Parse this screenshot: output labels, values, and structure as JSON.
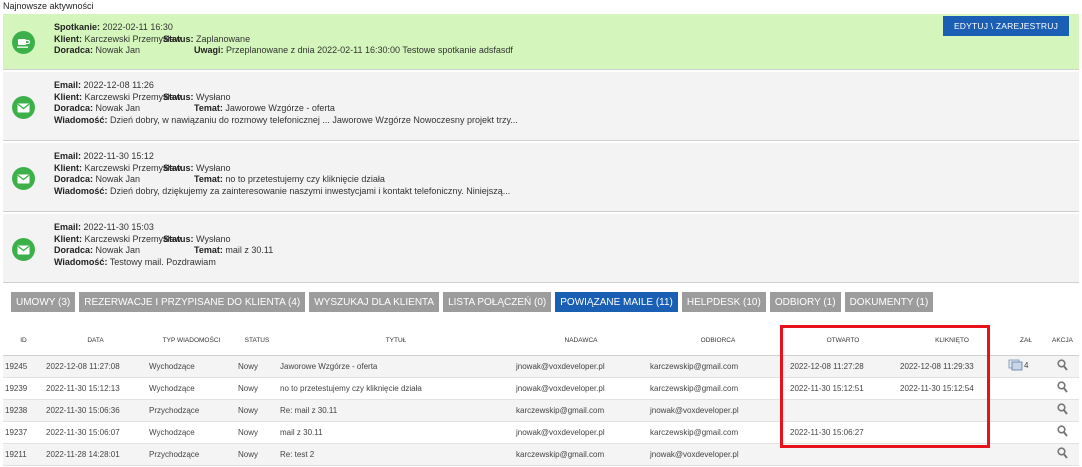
{
  "section_title": "Najnowsze aktywności",
  "labels": {
    "klient": "Klient",
    "doradca": "Doradca",
    "status": "Status",
    "temat": "Temat",
    "uwagi": "Uwagi",
    "wiadomosc": "Wiadomość",
    "spotkanie": "Spotkanie",
    "email": "Email"
  },
  "edit_button": "EDYTUJ \\ ZAREJESTRUJ",
  "activities": [
    {
      "date": "2022-02-11 16:30",
      "client": "Karczewski Przemysław",
      "status": "Zaplanowane",
      "advisor": "Nowak Jan",
      "notes": "Przeplanowane z dnia 2022-02-11 16:30:00 Testowe spotkanie adsfasdf"
    },
    {
      "date": "2022-12-08 11:26",
      "client": "Karczewski Przemysław",
      "status": "Wysłano",
      "advisor": "Nowak Jan",
      "subject": "Jaworowe Wzgórze - oferta",
      "message": "Dzień dobry, w nawiązaniu do rozmowy telefonicznej ...  Jaworowe Wzgórze Nowoczesny projekt trzy..."
    },
    {
      "date": "2022-11-30 15:12",
      "client": "Karczewski Przemysław",
      "status": "Wysłano",
      "advisor": "Nowak Jan",
      "subject": "no to przetestujemy czy kliknięcie działa",
      "message": "Dzień dobry, dziękujemy za zainteresowanie naszymi inwestycjami i kontakt telefoniczny. Niniejszą..."
    },
    {
      "date": "2022-11-30 15:03",
      "client": "Karczewski Przemysław",
      "status": "Wysłano",
      "advisor": "Nowak Jan",
      "subject": "mail z 30.11",
      "message": "Testowy mail. Pozdrawiam"
    }
  ],
  "tabs": [
    "UMOWY (3)",
    "REZERWACJE I PRZYPISANE DO KLIENTA (4)",
    "WYSZUKAJ DLA KLIENTA",
    "LISTA POŁĄCZEŃ (0)",
    "POWIĄZANE MAILE (11)",
    "HELPDESK (10)",
    "ODBIORY (1)",
    "DOKUMENTY (1)"
  ],
  "active_tab": 4,
  "table": {
    "headers": [
      "ID",
      "DATA",
      "TYP WIADOMOŚCI",
      "STATUS",
      "TYTUŁ",
      "NADAWCA",
      "ODBIORCA",
      "OTWARTO",
      "KLIKNIĘTO",
      "ZAŁ",
      "AKCJA"
    ],
    "rows": [
      {
        "id": "19245",
        "date": "2022-12-08 11:27:08",
        "type": "Wychodzące",
        "status": "Nowy",
        "title": "Jaworowe Wzgórze - oferta",
        "sender": "jnowak@voxdeveloper.pl",
        "recipient": "karczewskip@gmail.com",
        "opened": "2022-12-08 11:27:28",
        "clicked": "2022-12-08 11:29:33",
        "attachments": "4"
      },
      {
        "id": "19239",
        "date": "2022-11-30 15:12:13",
        "type": "Wychodzące",
        "status": "Nowy",
        "title": "no to przetestujemy czy kliknięcie działa",
        "sender": "jnowak@voxdeveloper.pl",
        "recipient": "karczewskip@gmail.com",
        "opened": "2022-11-30 15:12:51",
        "clicked": "2022-11-30 15:12:54",
        "attachments": ""
      },
      {
        "id": "19238",
        "date": "2022-11-30 15:06:36",
        "type": "Przychodzące",
        "status": "Nowy",
        "title": "Re: mail z 30.11",
        "sender": "karczewskip@gmail.com",
        "recipient": "jnowak@voxdeveloper.pl",
        "opened": "",
        "clicked": "",
        "attachments": ""
      },
      {
        "id": "19237",
        "date": "2022-11-30 15:06:07",
        "type": "Wychodzące",
        "status": "Nowy",
        "title": "mail z 30.11",
        "sender": "jnowak@voxdeveloper.pl",
        "recipient": "karczewskip@gmail.com",
        "opened": "2022-11-30 15:06:27",
        "clicked": "",
        "attachments": ""
      },
      {
        "id": "19211",
        "date": "2022-11-28 14:28:01",
        "type": "Przychodzące",
        "status": "Nowy",
        "title": "Re: test 2",
        "sender": "karczewskip@gmail.com",
        "recipient": "jnowak@voxdeveloper.pl",
        "opened": "",
        "clicked": "",
        "attachments": ""
      }
    ]
  },
  "icons": {
    "meeting": "coffee-cup-icon",
    "email": "envelope-icon",
    "attachment": "attachment-icon",
    "action": "magnifier-icon"
  },
  "colors": {
    "meeting_bg": "#d4f5bb",
    "email_bg": "#f3f3f3",
    "icon_green": "#3cb14a",
    "primary_blue": "#1a5fb4",
    "tab_grey": "#9c9c9c",
    "highlight_red": "#e8121a"
  }
}
